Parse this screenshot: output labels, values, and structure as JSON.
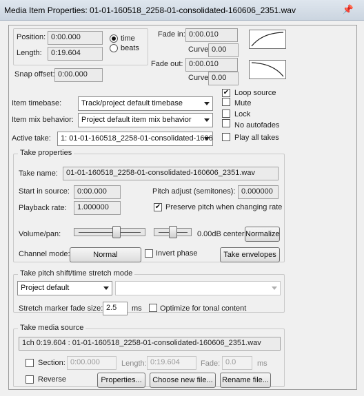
{
  "window": {
    "title": "Media Item Properties:  01-01-160518_2258-01-consolidated-160606_2351.wav",
    "pin_icon": "pin-icon"
  },
  "position": {
    "label": "Position:",
    "value": "0:00.000"
  },
  "length": {
    "label": "Length:",
    "value": "0:19.604"
  },
  "time_radio": {
    "label": "time",
    "selected": true
  },
  "beats_radio": {
    "label": "beats",
    "selected": false
  },
  "snap_offset": {
    "label": "Snap offset:",
    "value": "0:00.000"
  },
  "fade_in": {
    "label": "Fade in:",
    "value": "0:00.010",
    "curve_label": "Curve:",
    "curve_value": "0.00"
  },
  "fade_out": {
    "label": "Fade out:",
    "value": "0:00.010",
    "curve_label": "Curve:",
    "curve_value": "0.00"
  },
  "item_timebase": {
    "label": "Item timebase:",
    "value": "Track/project default timebase"
  },
  "item_mix": {
    "label": "Item mix behavior:",
    "value": "Project default item mix behavior"
  },
  "active_take": {
    "label": "Active take:",
    "value": "1: 01-01-160518_2258-01-consolidated-1606"
  },
  "options": [
    {
      "label": "Loop source",
      "checked": true
    },
    {
      "label": "Mute",
      "checked": false
    },
    {
      "label": "Lock",
      "checked": false
    },
    {
      "label": "No autofades",
      "checked": false
    },
    {
      "label": "Play all takes",
      "checked": false
    }
  ],
  "take_props": {
    "title": "Take properties",
    "name_label": "Take name:",
    "name_value": "01-01-160518_2258-01-consolidated-160606_2351.wav",
    "start_label": "Start in source:",
    "start_value": "0:00.000",
    "pitch_label": "Pitch adjust (semitones):",
    "pitch_value": "0.000000",
    "rate_label": "Playback rate:",
    "rate_value": "1.000000",
    "preserve_label": "Preserve pitch when changing rate",
    "preserve_checked": true,
    "volpan_label": "Volume/pan:",
    "volpan_readout": "0.00dB center",
    "normalize_label": "Normalize",
    "channel_label": "Channel mode:",
    "channel_value": "Normal",
    "invert_label": "Invert phase",
    "invert_checked": false,
    "envelopes_label": "Take envelopes"
  },
  "pitch_shift": {
    "title": "Take pitch shift/time stretch mode",
    "mode_value": "Project default",
    "submode_value": "",
    "fade_label": "Stretch marker fade size:",
    "fade_value": "2.5",
    "fade_unit": "ms",
    "optimize_label": "Optimize for tonal content",
    "optimize_checked": false
  },
  "media_source": {
    "title": "Take media source",
    "source_value": "1ch 0:19.604 : 01-01-160518_2258-01-consolidated-160606_2351.wav",
    "section_label": "Section:",
    "section_value": "0:00.000",
    "length_label": "Length:",
    "length_value": "0:19.604",
    "fade_label": "Fade:",
    "fade_value": "0.0",
    "fade_unit": "ms",
    "reverse_label": "Reverse",
    "properties_label": "Properties...",
    "choose_label": "Choose new file...",
    "rename_label": "Rename file..."
  }
}
